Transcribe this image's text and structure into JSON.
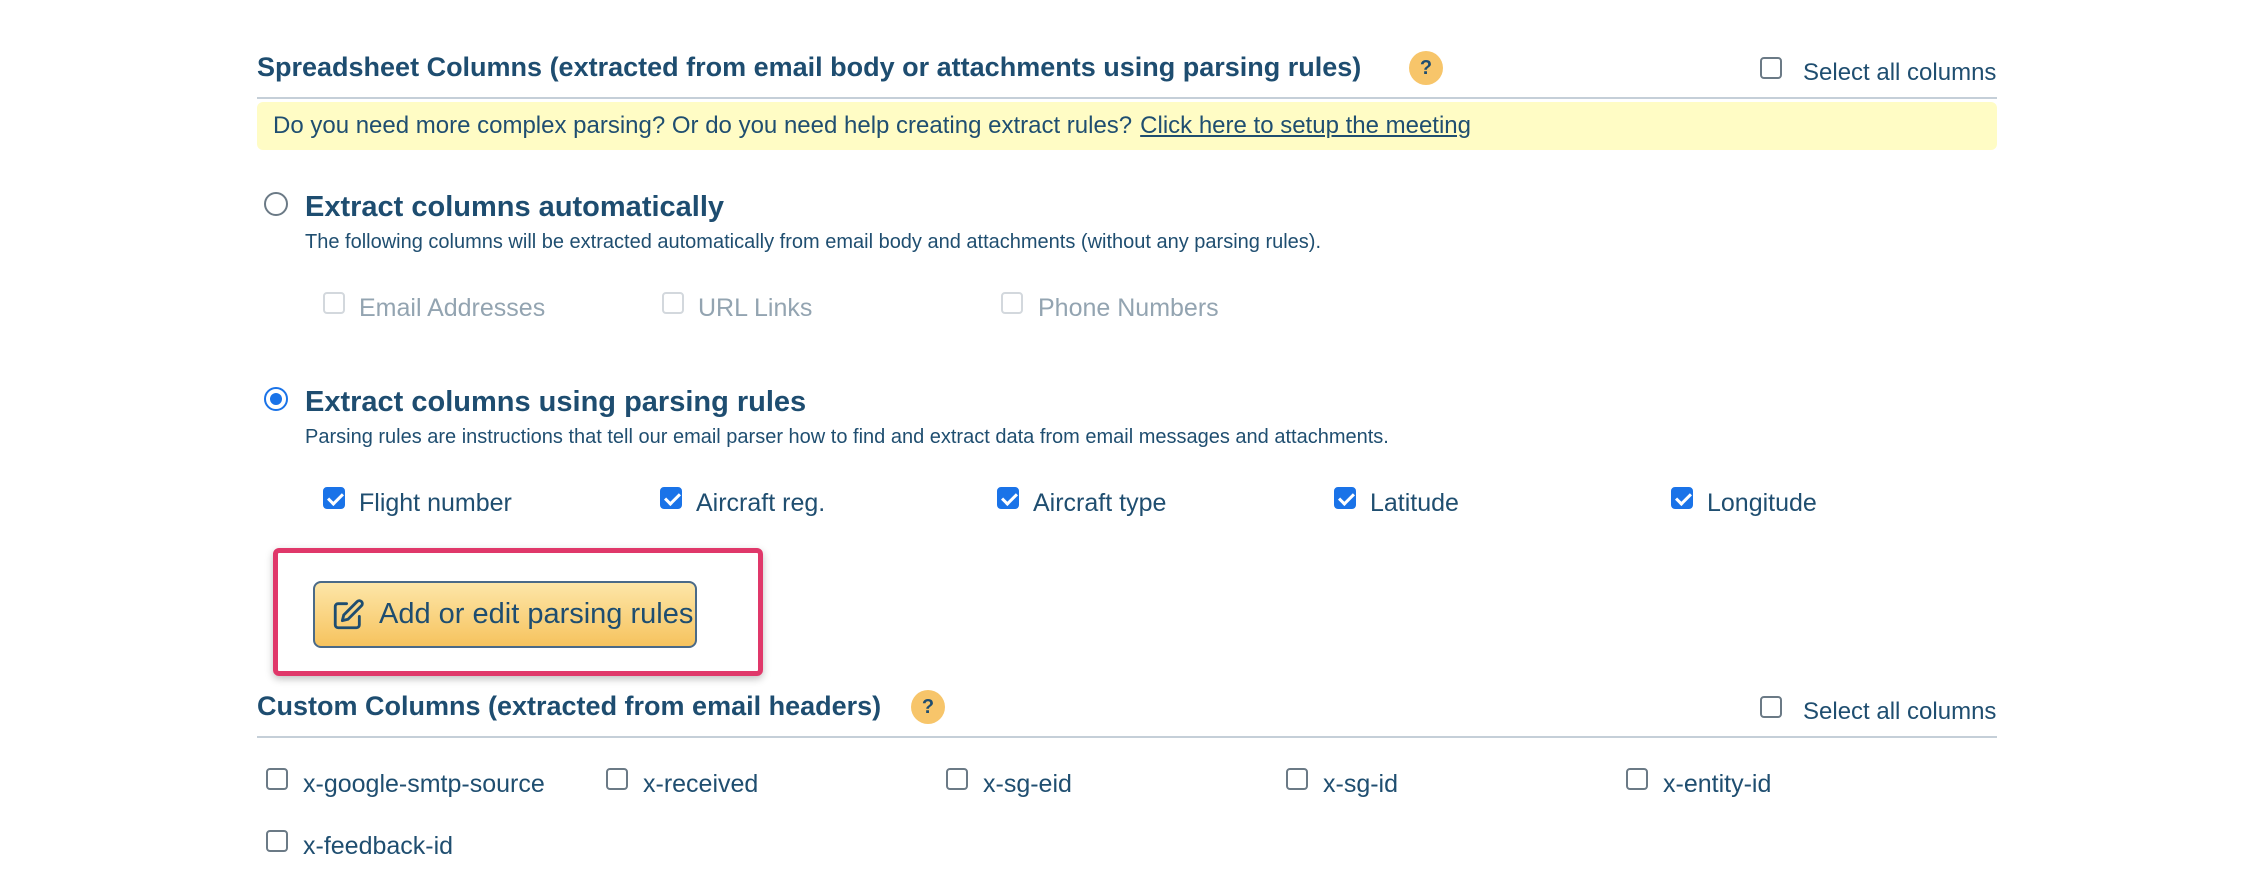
{
  "spreadsheet": {
    "title": "Spreadsheet Columns (extracted from email body or attachments using parsing rules)",
    "help": "?",
    "select_all": "Select all columns",
    "notice_text": "Do you need more complex parsing? Or do you need help creating extract rules?",
    "notice_link": "Click here to setup the meeting"
  },
  "auto_option": {
    "title": "Extract columns automatically",
    "description": "The following columns will be extracted automatically from email body and attachments (without any parsing rules).",
    "columns": [
      "Email Addresses",
      "URL Links",
      "Phone Numbers"
    ]
  },
  "rules_option": {
    "title": "Extract columns using parsing rules",
    "description": "Parsing rules are instructions that tell our email parser how to find and extract data from email messages and attachments.",
    "columns": [
      "Flight number",
      "Aircraft reg.",
      "Aircraft type",
      "Latitude",
      "Longitude"
    ],
    "edit_button": "Add or edit parsing rules"
  },
  "custom": {
    "title": "Custom Columns (extracted from email headers)",
    "help": "?",
    "select_all": "Select all columns",
    "columns": [
      "x-google-smtp-source",
      "x-received",
      "x-sg-eid",
      "x-sg-id",
      "x-entity-id",
      "x-feedback-id"
    ]
  },
  "colors": {
    "heading": "#1e4d70",
    "accent": "#1a73e8",
    "notice_bg": "#fffcc5",
    "help_badge": "#f7c56a",
    "highlight": "#e0386a"
  }
}
